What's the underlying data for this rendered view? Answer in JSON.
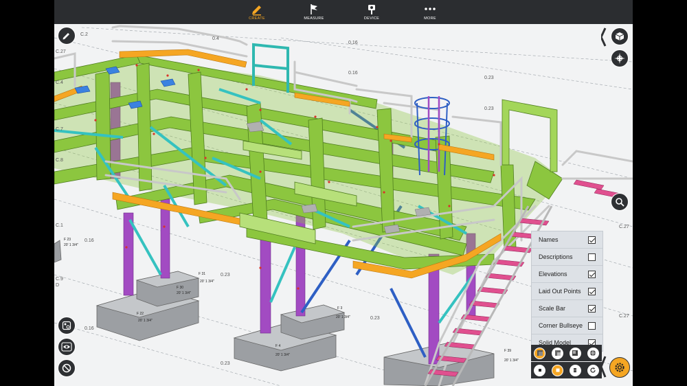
{
  "toolbar": {
    "create": "CREATE",
    "measure": "MEASURE",
    "device": "DEVICE",
    "more": "MORE"
  },
  "display_options": [
    {
      "label": "Names",
      "checked": true
    },
    {
      "label": "Descriptions",
      "checked": false
    },
    {
      "label": "Elevations",
      "checked": true
    },
    {
      "label": "Laid Out Points",
      "checked": true
    },
    {
      "label": "Scale Bar",
      "checked": true
    },
    {
      "label": "Corner Bullseye",
      "checked": false
    },
    {
      "label": "Solid Model",
      "checked": true
    }
  ],
  "grid_labels": {
    "c2": "C.2",
    "c27": "C.27",
    "c4": "C.4",
    "c7": "C.7",
    "c8": "C.8",
    "c9": "C.9",
    "d": "D",
    "c1": "C.1",
    "c27r": "C.27",
    "c27b": "C.27",
    "d016a": "0.16",
    "d016b": "0.16",
    "d023a": "0.23",
    "d023b": "0.23",
    "d016c": "0.16",
    "d023c": "0.23",
    "d023d": "0.23",
    "d016d": "0.16",
    "d023e": "0.23",
    "d04": "0.4"
  },
  "footing_labels": {
    "f23": "F 23",
    "f23e": "20' 1 3/4\"",
    "f31": "F 31",
    "f31e": "20' 1 3/4\"",
    "f3": "F 3",
    "f3e": "20' 1 3/4\"",
    "f22": "F 22",
    "f22e": "20' 1 3/4\"",
    "f4": "F 4",
    "f4e": "20' 1 3/4\"",
    "f39": "F 39",
    "f39e": "20' 1 3/4\"",
    "f30": "F 30",
    "f30e": "20' 1 3/4\""
  },
  "colors": {
    "steel": "#8cc63f",
    "column": "#a24bc2",
    "brace": "#35c2c0",
    "handrail": "#c8c8c8",
    "toe": "#f5a623",
    "stair": "#e0508f",
    "accent": "#f5a623"
  }
}
